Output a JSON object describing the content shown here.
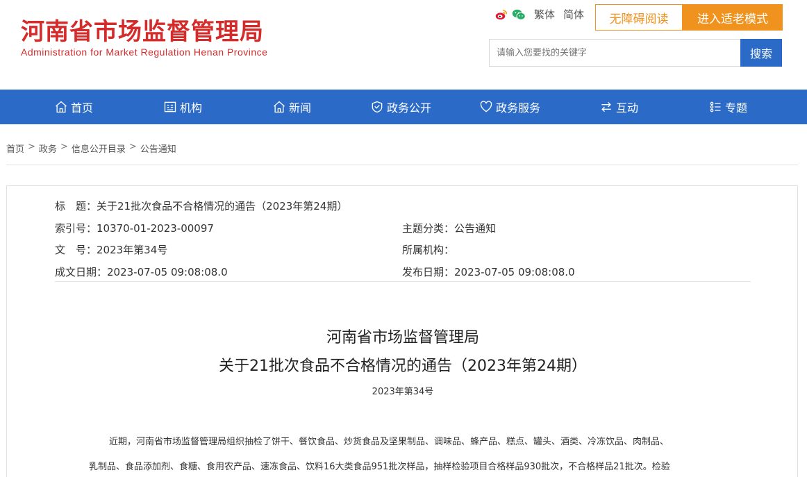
{
  "header": {
    "logo_cn": "河南省市场监督管理局",
    "logo_en": "Administration for Market Regulation Henan Province",
    "lang_traditional": "繁体",
    "lang_simplified": "简体",
    "accessibility_label": "无障碍阅读",
    "elder_mode_label": "进入适老模式",
    "search_placeholder": "请输入您要找的关键字",
    "search_button": "搜索"
  },
  "nav": {
    "items": [
      {
        "label": "首页",
        "icon": "home-icon"
      },
      {
        "label": "机构",
        "icon": "org-icon"
      },
      {
        "label": "新闻",
        "icon": "news-icon"
      },
      {
        "label": "政务公开",
        "icon": "shield-icon"
      },
      {
        "label": "政务服务",
        "icon": "heart-icon"
      },
      {
        "label": "互动",
        "icon": "exchange-icon"
      },
      {
        "label": "专题",
        "icon": "topic-icon"
      }
    ]
  },
  "breadcrumb": [
    "首页",
    "政务",
    "信息公开目录",
    "公告通知"
  ],
  "breadcrumb_sep": ">",
  "meta": {
    "title": "标　题：关于21批次食品不合格情况的通告（2023年第24期）",
    "index_no": "索引号：10370-01-2023-00097",
    "category": "主题分类：公告通知",
    "doc_no": "文　号：2023年第34号",
    "agency": "所属机构：",
    "created": "成文日期：2023-07-05 09:08:08.0",
    "published": "发布日期：2023-07-05 09:08:08.0"
  },
  "article": {
    "title_line1": "河南省市场监督管理局",
    "title_line2": "关于21批次食品不合格情况的通告（2023年第24期）",
    "doc_number": "2023年第34号",
    "body_line1": "近期，河南省市场监督管理局组织抽检了饼干、餐饮食品、炒货食品及坚果制品、调味品、蜂产品、糕点、罐头、酒类、冷冻饮品、肉制品、",
    "body_line2": "乳制品、食品添加剂、食糖、食用农产品、速冻食品、饮料16大类食品951批次样品，抽样检验项目合格样品930批次，不合格样品21批次。检验"
  },
  "colors": {
    "brand_red": "#d42b2b",
    "nav_blue": "#2b6bc7",
    "accent_orange": "#f0921e"
  }
}
